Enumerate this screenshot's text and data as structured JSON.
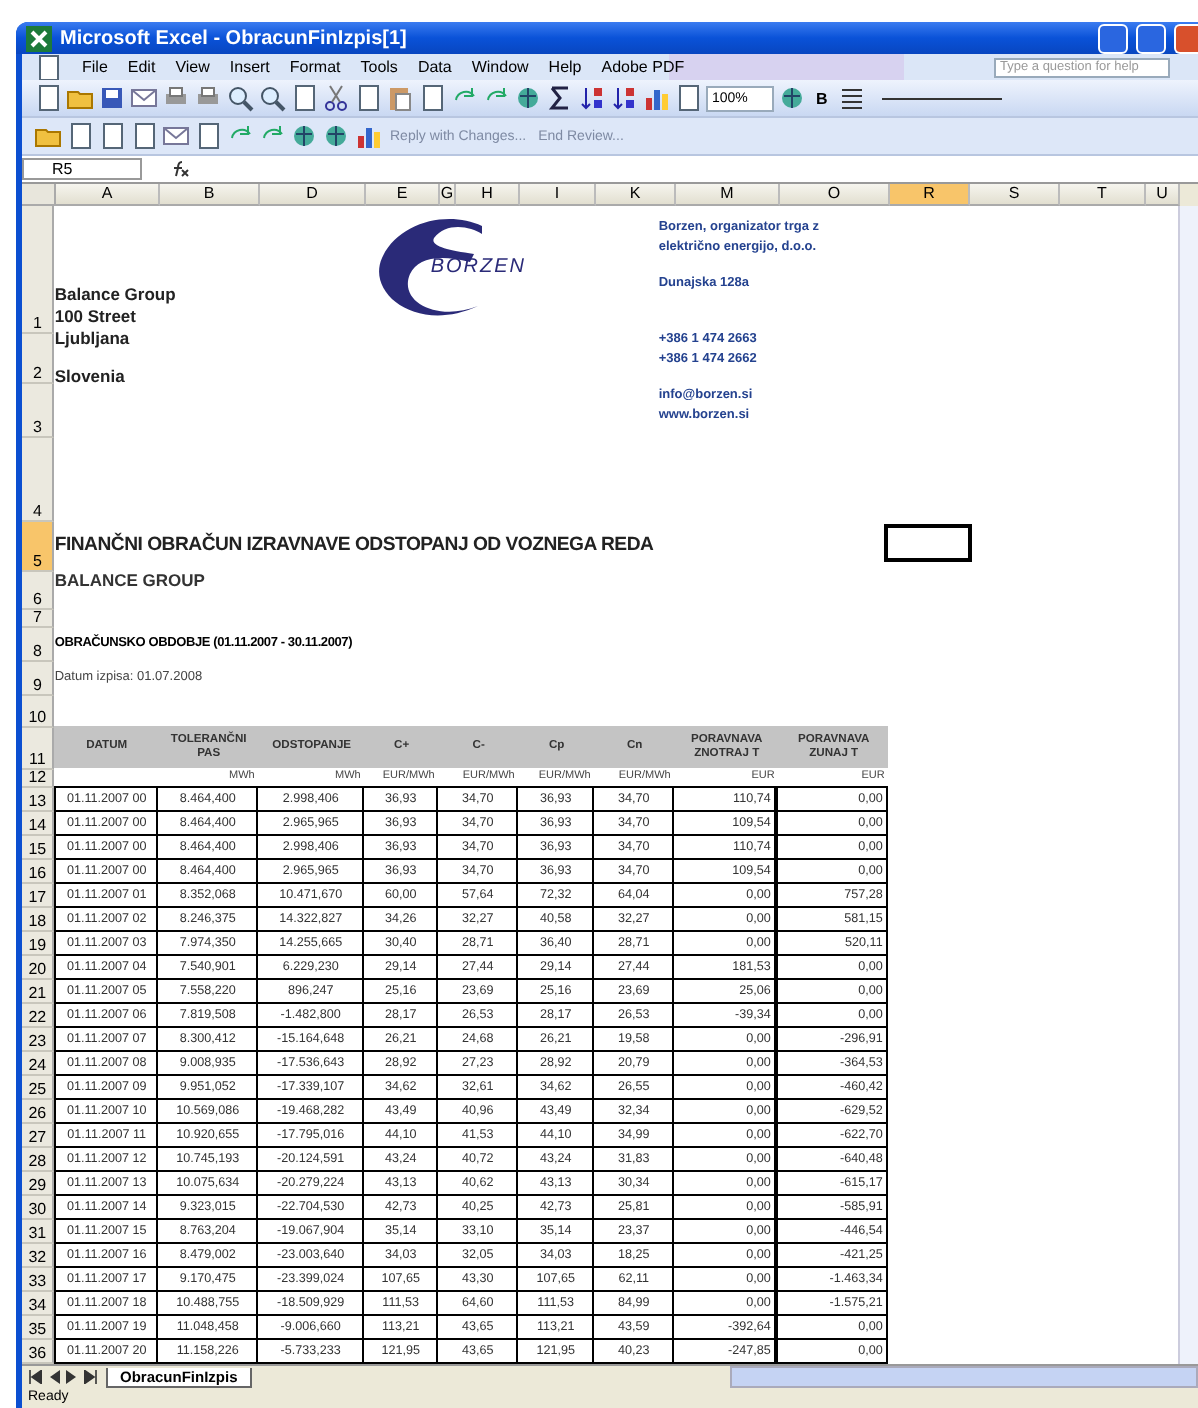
{
  "window": {
    "title": "Microsoft Excel - ObracunFinIzpis[1]"
  },
  "menu": [
    "File",
    "Edit",
    "View",
    "Insert",
    "Format",
    "Tools",
    "Data",
    "Window",
    "Help",
    "Adobe PDF"
  ],
  "help_box": {
    "placeholder": "Type a question for help"
  },
  "toolbar": {
    "zoom": "100%",
    "bold": "B"
  },
  "review_toolbar": {
    "reply": "Reply with Changes...",
    "end": "End Review..."
  },
  "formula_bar": {
    "name_box": "R5"
  },
  "columns": [
    {
      "label": "A",
      "selected": false
    },
    {
      "label": "B",
      "selected": false
    },
    {
      "label": "D",
      "selected": false
    },
    {
      "label": "E",
      "selected": false
    },
    {
      "label": "G",
      "selected": false
    },
    {
      "label": "H",
      "selected": false
    },
    {
      "label": "I",
      "selected": false
    },
    {
      "label": "K",
      "selected": false
    },
    {
      "label": "M",
      "selected": false
    },
    {
      "label": "O",
      "selected": false
    },
    {
      "label": "R",
      "selected": true
    },
    {
      "label": "S",
      "selected": false
    },
    {
      "label": "T",
      "selected": false
    },
    {
      "label": "U",
      "selected": false
    }
  ],
  "rows": [
    {
      "label": "1",
      "selected": false
    },
    {
      "label": "2",
      "selected": false
    },
    {
      "label": "3",
      "selected": false
    },
    {
      "label": "4",
      "selected": false
    },
    {
      "label": "5",
      "selected": true
    },
    {
      "label": "6",
      "selected": false
    },
    {
      "label": "7",
      "selected": false
    },
    {
      "label": "8",
      "selected": false
    },
    {
      "label": "9",
      "selected": false
    },
    {
      "label": "10",
      "selected": false
    },
    {
      "label": "11",
      "selected": false
    },
    {
      "label": "12",
      "selected": false
    },
    {
      "label": "13",
      "selected": false
    },
    {
      "label": "14",
      "selected": false
    },
    {
      "label": "15",
      "selected": false
    },
    {
      "label": "16",
      "selected": false
    },
    {
      "label": "17",
      "selected": false
    },
    {
      "label": "18",
      "selected": false
    },
    {
      "label": "19",
      "selected": false
    },
    {
      "label": "20",
      "selected": false
    },
    {
      "label": "21",
      "selected": false
    },
    {
      "label": "22",
      "selected": false
    },
    {
      "label": "23",
      "selected": false
    },
    {
      "label": "24",
      "selected": false
    },
    {
      "label": "25",
      "selected": false
    },
    {
      "label": "26",
      "selected": false
    },
    {
      "label": "27",
      "selected": false
    },
    {
      "label": "28",
      "selected": false
    },
    {
      "label": "29",
      "selected": false
    },
    {
      "label": "30",
      "selected": false
    },
    {
      "label": "31",
      "selected": false
    },
    {
      "label": "32",
      "selected": false
    },
    {
      "label": "33",
      "selected": false
    },
    {
      "label": "34",
      "selected": false
    },
    {
      "label": "35",
      "selected": false
    },
    {
      "label": "36",
      "selected": false
    }
  ],
  "letterhead": {
    "address": [
      [
        "Balance Group",
        "100 Street",
        "Ljubljana"
      ],
      [
        "Slovenia"
      ]
    ],
    "logo": "BORZEN",
    "company": [
      [
        "Borzen, organizator trga z",
        "električno energijo, d.o.o."
      ],
      [
        "Dunajska 128a"
      ],
      [
        "+386 1 474 2663",
        "+386 1 474 2662"
      ],
      [
        "info@borzen.si",
        "www.borzen.si"
      ]
    ]
  },
  "title": "FINANČNI OBRAČUN IZRAVNAVE ODSTOPANJ OD VOZNEGA REDA",
  "subtitle": "BALANCE GROUP",
  "period": "OBRAČUNSKO OBDOBJE (01.11.2007 - 30.11.2007)",
  "print_date": "Datum izpisa: 01.07.2008",
  "table": {
    "columns": [
      {
        "label": "DATUM"
      },
      {
        "label": "TOLERANČNI PAS",
        "unit": "MWh"
      },
      {
        "label": "ODSTOPANJE",
        "unit": "MWh"
      },
      {
        "label": "C+",
        "unit": "EUR/MWh"
      },
      {
        "label": "C-",
        "unit": "EUR/MWh"
      },
      {
        "label": "Cp",
        "unit": "EUR/MWh"
      },
      {
        "label": "Cn",
        "unit": "EUR/MWh"
      },
      {
        "label": "PORAVNAVA ZNOTRAJ T",
        "unit": "EUR"
      },
      {
        "label": "PORAVNAVA ZUNAJ T",
        "unit": "EUR"
      }
    ],
    "rows": [
      [
        "01.11.2007 00",
        "8.464,400",
        "2.998,406",
        "36,93",
        "34,70",
        "36,93",
        "34,70",
        "110,74",
        "0,00"
      ],
      [
        "01.11.2007 00",
        "8.464,400",
        "2.965,965",
        "36,93",
        "34,70",
        "36,93",
        "34,70",
        "109,54",
        "0,00"
      ],
      [
        "01.11.2007 00",
        "8.464,400",
        "2.998,406",
        "36,93",
        "34,70",
        "36,93",
        "34,70",
        "110,74",
        "0,00"
      ],
      [
        "01.11.2007 00",
        "8.464,400",
        "2.965,965",
        "36,93",
        "34,70",
        "36,93",
        "34,70",
        "109,54",
        "0,00"
      ],
      [
        "01.11.2007 01",
        "8.352,068",
        "10.471,670",
        "60,00",
        "57,64",
        "72,32",
        "64,04",
        "0,00",
        "757,28"
      ],
      [
        "01.11.2007 02",
        "8.246,375",
        "14.322,827",
        "34,26",
        "32,27",
        "40,58",
        "32,27",
        "0,00",
        "581,15"
      ],
      [
        "01.11.2007 03",
        "7.974,350",
        "14.255,665",
        "30,40",
        "28,71",
        "36,40",
        "28,71",
        "0,00",
        "520,11"
      ],
      [
        "01.11.2007 04",
        "7.540,901",
        "6.229,230",
        "29,14",
        "27,44",
        "29,14",
        "27,44",
        "181,53",
        "0,00"
      ],
      [
        "01.11.2007 05",
        "7.558,220",
        "896,247",
        "25,16",
        "23,69",
        "25,16",
        "23,69",
        "25,06",
        "0,00"
      ],
      [
        "01.11.2007 06",
        "7.819,508",
        "-1.482,800",
        "28,17",
        "26,53",
        "28,17",
        "26,53",
        "-39,34",
        "0,00"
      ],
      [
        "01.11.2007 07",
        "8.300,412",
        "-15.164,648",
        "26,21",
        "24,68",
        "26,21",
        "19,58",
        "0,00",
        "-296,91"
      ],
      [
        "01.11.2007 08",
        "9.008,935",
        "-17.536,643",
        "28,92",
        "27,23",
        "28,92",
        "20,79",
        "0,00",
        "-364,53"
      ],
      [
        "01.11.2007 09",
        "9.951,052",
        "-17.339,107",
        "34,62",
        "32,61",
        "34,62",
        "26,55",
        "0,00",
        "-460,42"
      ],
      [
        "01.11.2007 10",
        "10.569,086",
        "-19.468,282",
        "43,49",
        "40,96",
        "43,49",
        "32,34",
        "0,00",
        "-629,52"
      ],
      [
        "01.11.2007 11",
        "10.920,655",
        "-17.795,016",
        "44,10",
        "41,53",
        "44,10",
        "34,99",
        "0,00",
        "-622,70"
      ],
      [
        "01.11.2007 12",
        "10.745,193",
        "-20.124,591",
        "43,24",
        "40,72",
        "43,24",
        "31,83",
        "0,00",
        "-640,48"
      ],
      [
        "01.11.2007 13",
        "10.075,634",
        "-20.279,224",
        "43,13",
        "40,62",
        "43,13",
        "30,34",
        "0,00",
        "-615,17"
      ],
      [
        "01.11.2007 14",
        "9.323,015",
        "-22.704,530",
        "42,73",
        "40,25",
        "42,73",
        "25,81",
        "0,00",
        "-585,91"
      ],
      [
        "01.11.2007 15",
        "8.763,204",
        "-19.067,904",
        "35,14",
        "33,10",
        "35,14",
        "23,37",
        "0,00",
        "-446,54"
      ],
      [
        "01.11.2007 16",
        "8.479,002",
        "-23.003,640",
        "34,03",
        "32,05",
        "34,03",
        "18,25",
        "0,00",
        "-421,25"
      ],
      [
        "01.11.2007 17",
        "9.170,475",
        "-23.399,024",
        "107,65",
        "43,30",
        "107,65",
        "62,11",
        "0,00",
        "-1.463,34"
      ],
      [
        "01.11.2007 18",
        "10.488,755",
        "-18.509,929",
        "111,53",
        "64,60",
        "111,53",
        "84,99",
        "0,00",
        "-1.575,21"
      ],
      [
        "01.11.2007 19",
        "11.048,458",
        "-9.006,660",
        "113,21",
        "43,65",
        "113,21",
        "43,59",
        "-392,64",
        "0,00"
      ],
      [
        "01.11.2007 20",
        "11.158,226",
        "-5.733,233",
        "121,95",
        "43,65",
        "121,95",
        "40,23",
        "-247,85",
        "0,00"
      ]
    ]
  },
  "sheet_tabs": [
    {
      "label": "ObracunFinIzpis",
      "selected": true
    }
  ],
  "status_bar": "Ready"
}
